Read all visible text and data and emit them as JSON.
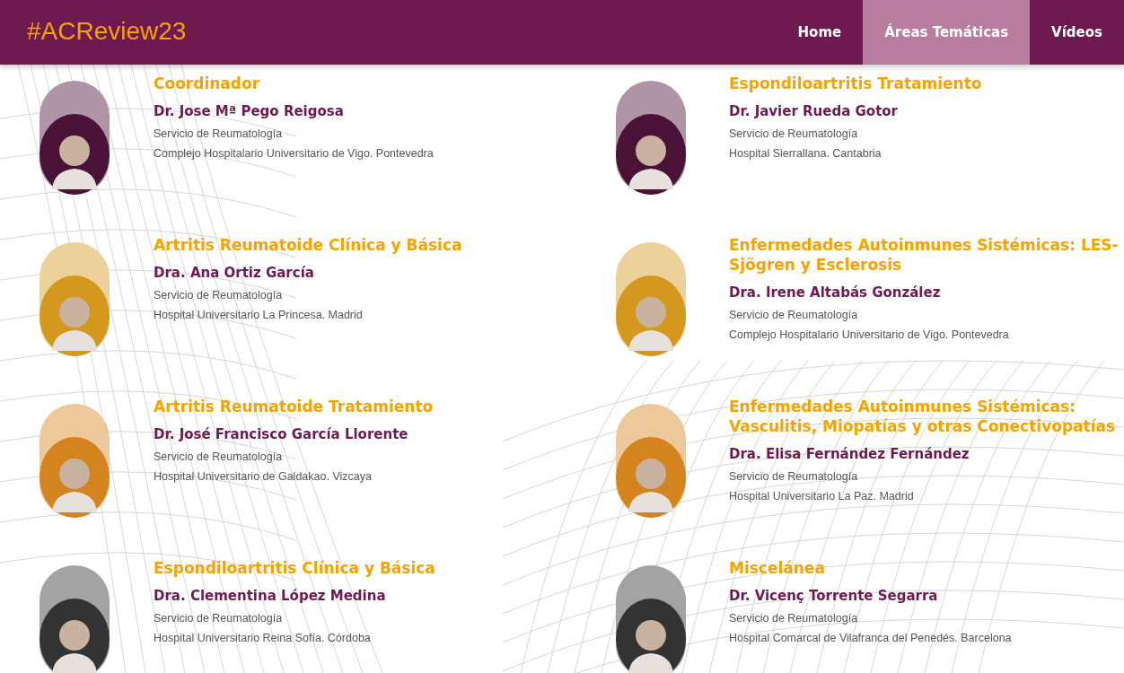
{
  "brand": "#ACReview23",
  "nav": [
    {
      "label": "Home",
      "selected": false
    },
    {
      "label": "Áreas Temáticas",
      "selected": true
    },
    {
      "label": "Vídeos",
      "selected": false
    }
  ],
  "speakers": [
    {
      "area": "Coordinador",
      "name": "Dr. Jose Mª Pego Reigosa",
      "department": "Servicio de Reumatología",
      "hospital": "Complejo Hospitalario Universitario de Vigo. Pontevedra",
      "color": "#4a1236"
    },
    {
      "area": "Espondiloartritis Tratamiento",
      "name": "Dr. Javier Rueda Gotor",
      "department": "Servicio de Reumatología",
      "hospital": "Hospital Sierrallana. Cantabria",
      "color": "#4a1236"
    },
    {
      "area": "Artritis Reumatoide Clínica y Básica",
      "name": "Dra. Ana Ortiz García",
      "department": "Servicio de Reumatología",
      "hospital": "Hospital Universitario La Princesa. Madrid",
      "color": "#d4981f"
    },
    {
      "area": "Enfermedades Autoinmunes Sistémicas: LES-Sjögren y Esclerosis",
      "name": "Dra. Irene Altabás González",
      "department": "Servicio de Reumatología",
      "hospital": "Complejo Hospitalario Universitario de Vigo. Pontevedra",
      "color": "#d4981f"
    },
    {
      "area": "Artritis Reumatoide Tratamiento",
      "name": "Dr. José Francisco García Llorente",
      "department": "Servicio de Reumatología",
      "hospital": "Hospital Universitario de Galdakao. Vizcaya",
      "color": "#d4841f"
    },
    {
      "area": "Enfermedades Autoinmunes Sistémicas: Vasculitis, Miopatías y otras Conectivopatías",
      "name": "Dra. Elisa Fernández Fernández",
      "department": "Servicio de Reumatología",
      "hospital": "Hospital Universitario La Paz. Madrid",
      "color": "#d4841f"
    },
    {
      "area": "Espondiloartritis Clínica y Básica",
      "name": "Dra. Clementina López Medina",
      "department": "Servicio de Reumatología",
      "hospital": "Hospital Universitario Reina Sofía. Córdoba",
      "color": "#333333"
    },
    {
      "area": "Miscelánea",
      "name": "Dr. Vicenç Torrente Segarra",
      "department": "Servicio de Reumatología",
      "hospital": "Hospital Comarcal de Vilafranca del Penedés. Barcelona",
      "color": "#333333"
    }
  ]
}
